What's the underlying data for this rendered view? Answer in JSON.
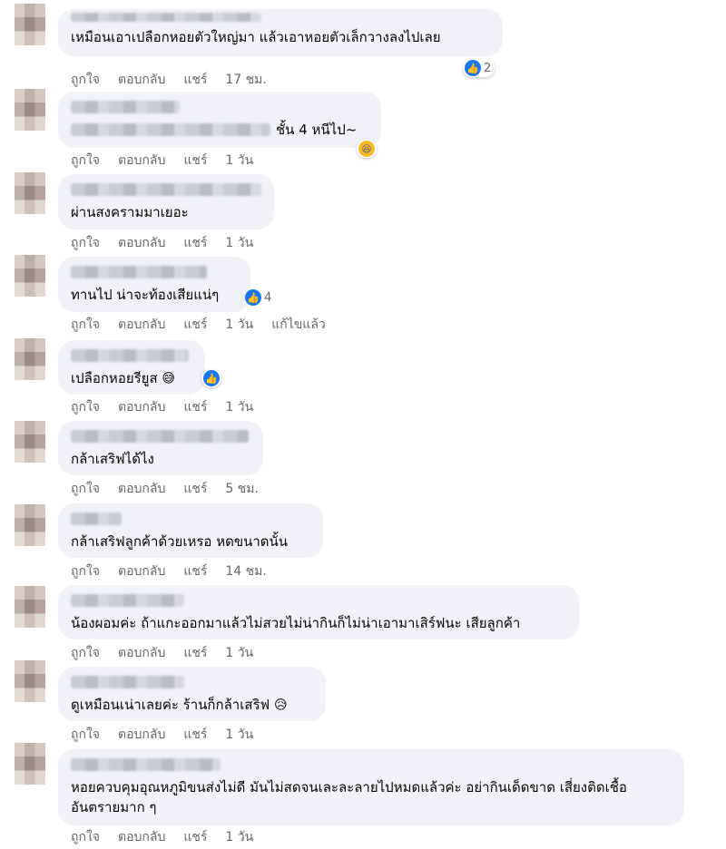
{
  "action_labels": {
    "like": "ถูกใจ",
    "reply": "ตอบกลับ",
    "share": "แชร์"
  },
  "comments": [
    {
      "text": "เหมือนเอาเปลือกหอยตัวใหญ่มา แล้วเอาหอยตัวเล็กวางลงไปเลย",
      "time": "17 ชม.",
      "reaction_count": "2"
    },
    {
      "text": "ชั้น 4 หนีไป~",
      "time": "1 วัน"
    },
    {
      "text": "ผ่านสงครามมาเยอะ",
      "time": "1 วัน"
    },
    {
      "text": "ทานไป น่าจะท้องเสียแน่ๆ",
      "time": "1 วัน",
      "reaction_count": "4",
      "edited": "แก้ไขแล้ว"
    },
    {
      "text": "เปลือกหอยรียูส",
      "time": "1 วัน"
    },
    {
      "text": "กล้าเสริฟได้ไง",
      "time": "5 ชม."
    },
    {
      "text": "กล้าเสริฟลูกค้าด้วยเหรอ หดขนาดนั้น",
      "time": "14 ชม."
    },
    {
      "text": "น้องผอมค่ะ ถ้าแกะออกมาแล้วไม่สวยไม่น่ากินก็ไม่น่าเอามาเสิร์ฟนะ เสียลูกค้า",
      "time": "1 วัน"
    },
    {
      "text": "ดูเหมือนเน่าเลยค่ะ ร้านก็กล้าเสริฟ",
      "time": "1 วัน"
    },
    {
      "text": "หอยควบคุมอุณหภูมิขนส่งไม่ดี มันไม่สดจนเละละลายไปหมดแล้วค่ะ อย่ากินเด็ดขาด เสี่ยงติดเชื้ออันตรายมาก ๆ",
      "time": "1 วัน"
    }
  ],
  "icons": {
    "like": "thumbs-up-icon",
    "haha": "laughing-emoji-icon",
    "grin": "grinning-emoji-icon",
    "sad": "sad-emoji-icon"
  },
  "colors": {
    "bubble": "#f0f2f5",
    "meta": "#65676b",
    "like_blue": "#1877f2"
  }
}
